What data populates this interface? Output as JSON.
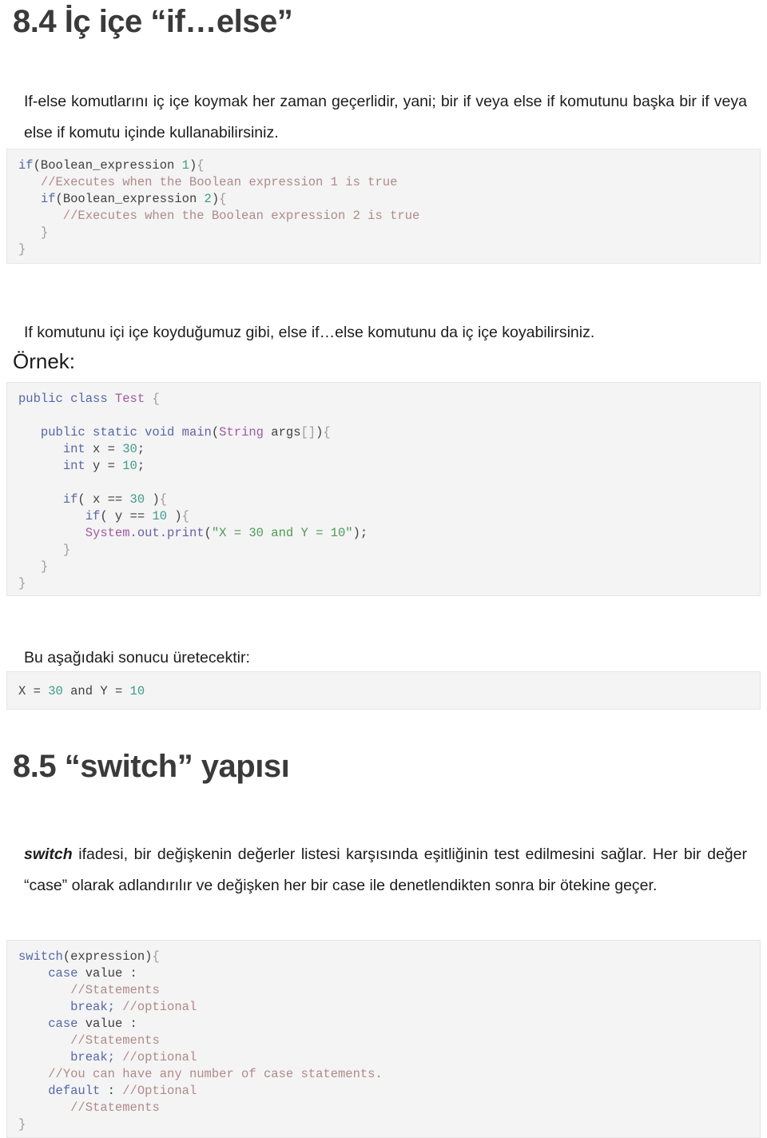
{
  "document": {
    "language": "tr",
    "type": "lecture-notes-page",
    "background_color": "#ffffff",
    "text_color": "#1c1c1c"
  },
  "headings": {
    "section_84": "8.4 İç içe “if…else”",
    "section_85": "8.5 “switch” yapısı",
    "ornek_label": "Örnek:"
  },
  "paragraphs": {
    "intro": "If-else komutlarını iç içe koymak her zaman geçerlidir, yani; bir if veya else if komutunu başka bir if veya else if komutu içinde kullanabilirsiniz.",
    "mid": "If komutunu içi içe koyduğumuz gibi, else if…else komutunu da iç içe koyabilirsiniz.",
    "output_label": "Bu aşağıdaki sonucu üretecektir:",
    "switch_lead": "switch",
    "switch_rest": " ifadesi, bir değişkenin değerler listesi karşısında eşitliğinin test edilmesini sağlar. Her bir değer “case” olarak adlandırılır ve değişken her bir case ile denetlendikten sonra bir ötekine geçer."
  },
  "code_blocks": {
    "nested_if": {
      "name": "nested-if-syntax",
      "background": "#f4f4f4",
      "lines": [
        "if(Boolean_expression 1){",
        "   //Executes when the Boolean expression 1 is true",
        "   if(Boolean_expression 2){",
        "      //Executes when the Boolean expression 2 is true",
        "   }",
        "}"
      ]
    },
    "example": {
      "name": "nested-if-example",
      "background": "#f4f4f4",
      "lines": [
        "public class Test {",
        "",
        "   public static void main(String args[]){",
        "      int x = 30;",
        "      int y = 10;",
        "",
        "      if( x == 30 ){",
        "         if( y == 10 ){",
        "         System.out.print(\"X = 30 and Y = 10\");",
        "      }",
        "   }",
        "}"
      ]
    },
    "output": {
      "name": "program-output",
      "background": "#f4f4f4",
      "lines": [
        "X = 30 and Y = 10"
      ]
    },
    "switch_syntax": {
      "name": "switch-syntax",
      "background": "#f4f4f4",
      "lines": [
        "switch(expression){",
        "    case value :",
        "       //Statements",
        "       break; //optional",
        "    case value :",
        "       //Statements",
        "       break; //optional",
        "    //You can have any number of case statements.",
        "    default : //Optional",
        "       //Statements",
        "}"
      ]
    }
  },
  "syntax_colors": {
    "keyword": "#5667a8",
    "class_name": "#a05ba0",
    "number": "#3d9a8b",
    "comment": "#b08a8a",
    "string": "#4c9a56",
    "method": "#6a5fa8",
    "plain": "#3f3f3f",
    "brace": "#9c9c9c"
  }
}
